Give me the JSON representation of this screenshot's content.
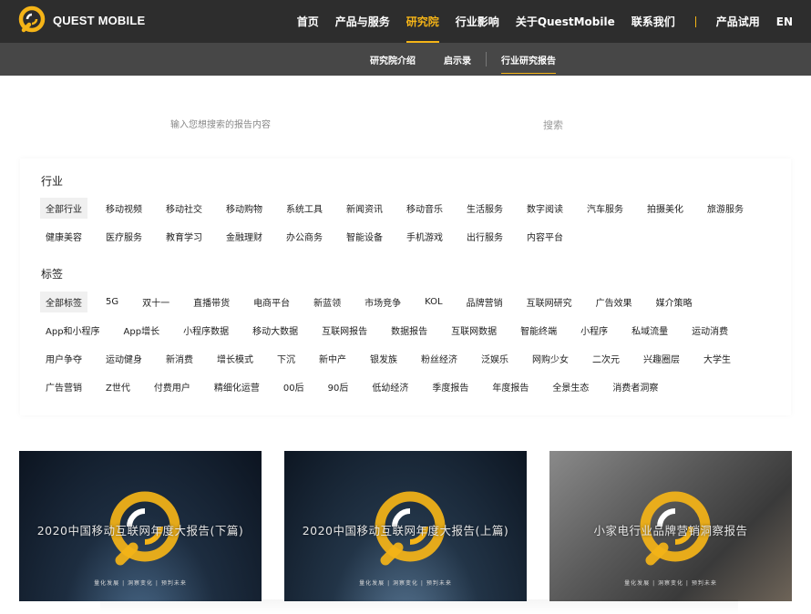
{
  "brand": {
    "name": "QUEST MOBILE",
    "accent": "#f5b417"
  },
  "nav": {
    "items": [
      "首页",
      "产品与服务",
      "研究院",
      "行业影响",
      "关于QuestMobile",
      "联系我们"
    ],
    "active_index": 2,
    "trial": "产品试用",
    "lang": "EN"
  },
  "subnav": {
    "items": [
      "研究院介绍",
      "启示录",
      "行业研究报告"
    ],
    "active_index": 2
  },
  "search": {
    "placeholder": "输入您想搜索的报告内容",
    "button": "搜索"
  },
  "filters": {
    "industry": {
      "title": "行业",
      "rows": [
        [
          "全部行业",
          "移动视频",
          "移动社交",
          "移动购物",
          "系统工具",
          "新闻资讯",
          "移动音乐",
          "生活服务",
          "数字阅读",
          "汽车服务",
          "拍摄美化",
          "旅游服务"
        ],
        [
          "健康美容",
          "医疗服务",
          "教育学习",
          "金融理财",
          "办公商务",
          "智能设备",
          "手机游戏",
          "出行服务",
          "内容平台"
        ]
      ]
    },
    "tags": {
      "title": "标签",
      "rows": [
        [
          "全部标签",
          "5G",
          "双十一",
          "直播带货",
          "电商平台",
          "新蓝领",
          "市场竞争",
          "KOL",
          "品牌营销",
          "互联网研究",
          "广告效果",
          "媒介策略"
        ],
        [
          "App和小程序",
          "App增长",
          "小程序数据",
          "移动大数据",
          "互联网报告",
          "数据报告",
          "互联网数据",
          "智能终端",
          "小程序",
          "私域流量",
          "运动消费"
        ],
        [
          "用户争夺",
          "运动健身",
          "新消费",
          "增长模式",
          "下沉",
          "新中产",
          "银发族",
          "粉丝经济",
          "泛娱乐",
          "网购少女",
          "二次元",
          "兴趣圈层",
          "大学生"
        ],
        [
          "广告营销",
          "Z世代",
          "付费用户",
          "精细化运营",
          "00后",
          "90后",
          "低幼经济",
          "季度报告",
          "年度报告",
          "全景生态",
          "消费者洞察"
        ]
      ]
    }
  },
  "reports": [
    {
      "title": "2020中国移动互联网年度大报告(下篇)",
      "slogan": "量化发展 | 洞察变化 | 预判未来"
    },
    {
      "title": "2020中国移动互联网年度大报告(上篇)",
      "slogan": "量化发展 | 洞察变化 | 预判未来"
    },
    {
      "title": "小家电行业品牌营销洞察报告",
      "slogan": "量化发展 | 洞察变化 | 预判未来"
    }
  ]
}
